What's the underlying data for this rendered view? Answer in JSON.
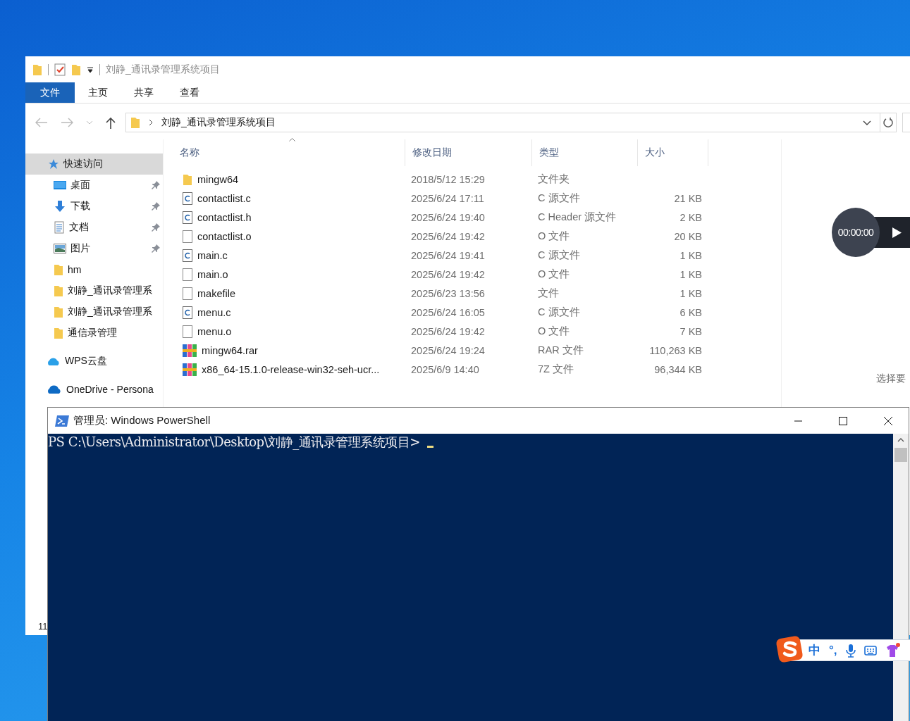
{
  "explorer": {
    "title": "刘静_通讯录管理系统项目",
    "ribbon_tabs": [
      {
        "label": "文件",
        "selected": true
      },
      {
        "label": "主页",
        "selected": false
      },
      {
        "label": "共享",
        "selected": false
      },
      {
        "label": "查看",
        "selected": false
      }
    ],
    "address": "刘静_通讯录管理系统项目",
    "sidebar": {
      "items": [
        {
          "label": "快速访问",
          "kind": "star",
          "selected": true,
          "children": [
            {
              "label": "桌面",
              "kind": "desktop",
              "selected": false,
              "pinned": true
            },
            {
              "label": "下载",
              "kind": "download",
              "selected": false,
              "pinned": true
            },
            {
              "label": "文档",
              "kind": "document",
              "selected": false,
              "pinned": true
            },
            {
              "label": "图片",
              "kind": "pictures",
              "selected": false,
              "pinned": true
            },
            {
              "label": "hm",
              "kind": "folder",
              "selected": false,
              "pinned": false
            },
            {
              "label": "刘静_通讯录管理系",
              "kind": "folder",
              "selected": false,
              "pinned": false
            },
            {
              "label": "刘静_通讯录管理系",
              "kind": "folder",
              "selected": false,
              "pinned": false
            },
            {
              "label": "通信录管理",
              "kind": "folder",
              "selected": false,
              "pinned": false
            }
          ]
        },
        {
          "label": "WPS云盘",
          "kind": "wps-cloud",
          "selected": false
        },
        {
          "label": "OneDrive - Persona",
          "kind": "onedrive",
          "selected": false
        }
      ]
    },
    "table": {
      "columns": [
        {
          "label": "名称",
          "sorted": true
        },
        {
          "label": "修改日期",
          "sorted": false
        },
        {
          "label": "类型",
          "sorted": false
        },
        {
          "label": "大小",
          "sorted": false
        }
      ],
      "rows": [
        {
          "name": "mingw64",
          "date": "2018/5/12 15:29",
          "type": "文件夹",
          "size": "",
          "kind": "folder"
        },
        {
          "name": "contactlist.c",
          "date": "2025/6/24 17:11",
          "type": "C 源文件",
          "size": "21 KB",
          "kind": "c-file"
        },
        {
          "name": "contactlist.h",
          "date": "2025/6/24 19:40",
          "type": "C Header 源文件",
          "size": "2 KB",
          "kind": "c-file"
        },
        {
          "name": "contactlist.o",
          "date": "2025/6/24 19:42",
          "type": "O 文件",
          "size": "20 KB",
          "kind": "file"
        },
        {
          "name": "main.c",
          "date": "2025/6/24 19:41",
          "type": "C 源文件",
          "size": "1 KB",
          "kind": "c-file"
        },
        {
          "name": "main.o",
          "date": "2025/6/24 19:42",
          "type": "O 文件",
          "size": "1 KB",
          "kind": "file"
        },
        {
          "name": "makefile",
          "date": "2025/6/23 13:56",
          "type": "文件",
          "size": "1 KB",
          "kind": "file"
        },
        {
          "name": "menu.c",
          "date": "2025/6/24 16:05",
          "type": "C 源文件",
          "size": "6 KB",
          "kind": "c-file"
        },
        {
          "name": "menu.o",
          "date": "2025/6/24 19:42",
          "type": "O 文件",
          "size": "7 KB",
          "kind": "file"
        },
        {
          "name": "mingw64.rar",
          "date": "2025/6/24 19:24",
          "type": "RAR 文件",
          "size": "110,263 KB",
          "kind": "archive"
        },
        {
          "name": "x86_64-15.1.0-release-win32-seh-ucr...",
          "date": "2025/6/9 14:40",
          "type": "7Z 文件",
          "size": "96,344 KB",
          "kind": "archive"
        }
      ]
    },
    "preview_hint": "选择要",
    "status_bar": "11"
  },
  "recorder": {
    "timer": "00:00:00"
  },
  "powershell": {
    "title": "管理员: Windows PowerShell",
    "prompt": "PS C:\\Users\\Administrator\\Desktop\\刘静_通讯录管理系统项目>"
  },
  "ime": {
    "mode": "中",
    "punctuation": "°,"
  }
}
